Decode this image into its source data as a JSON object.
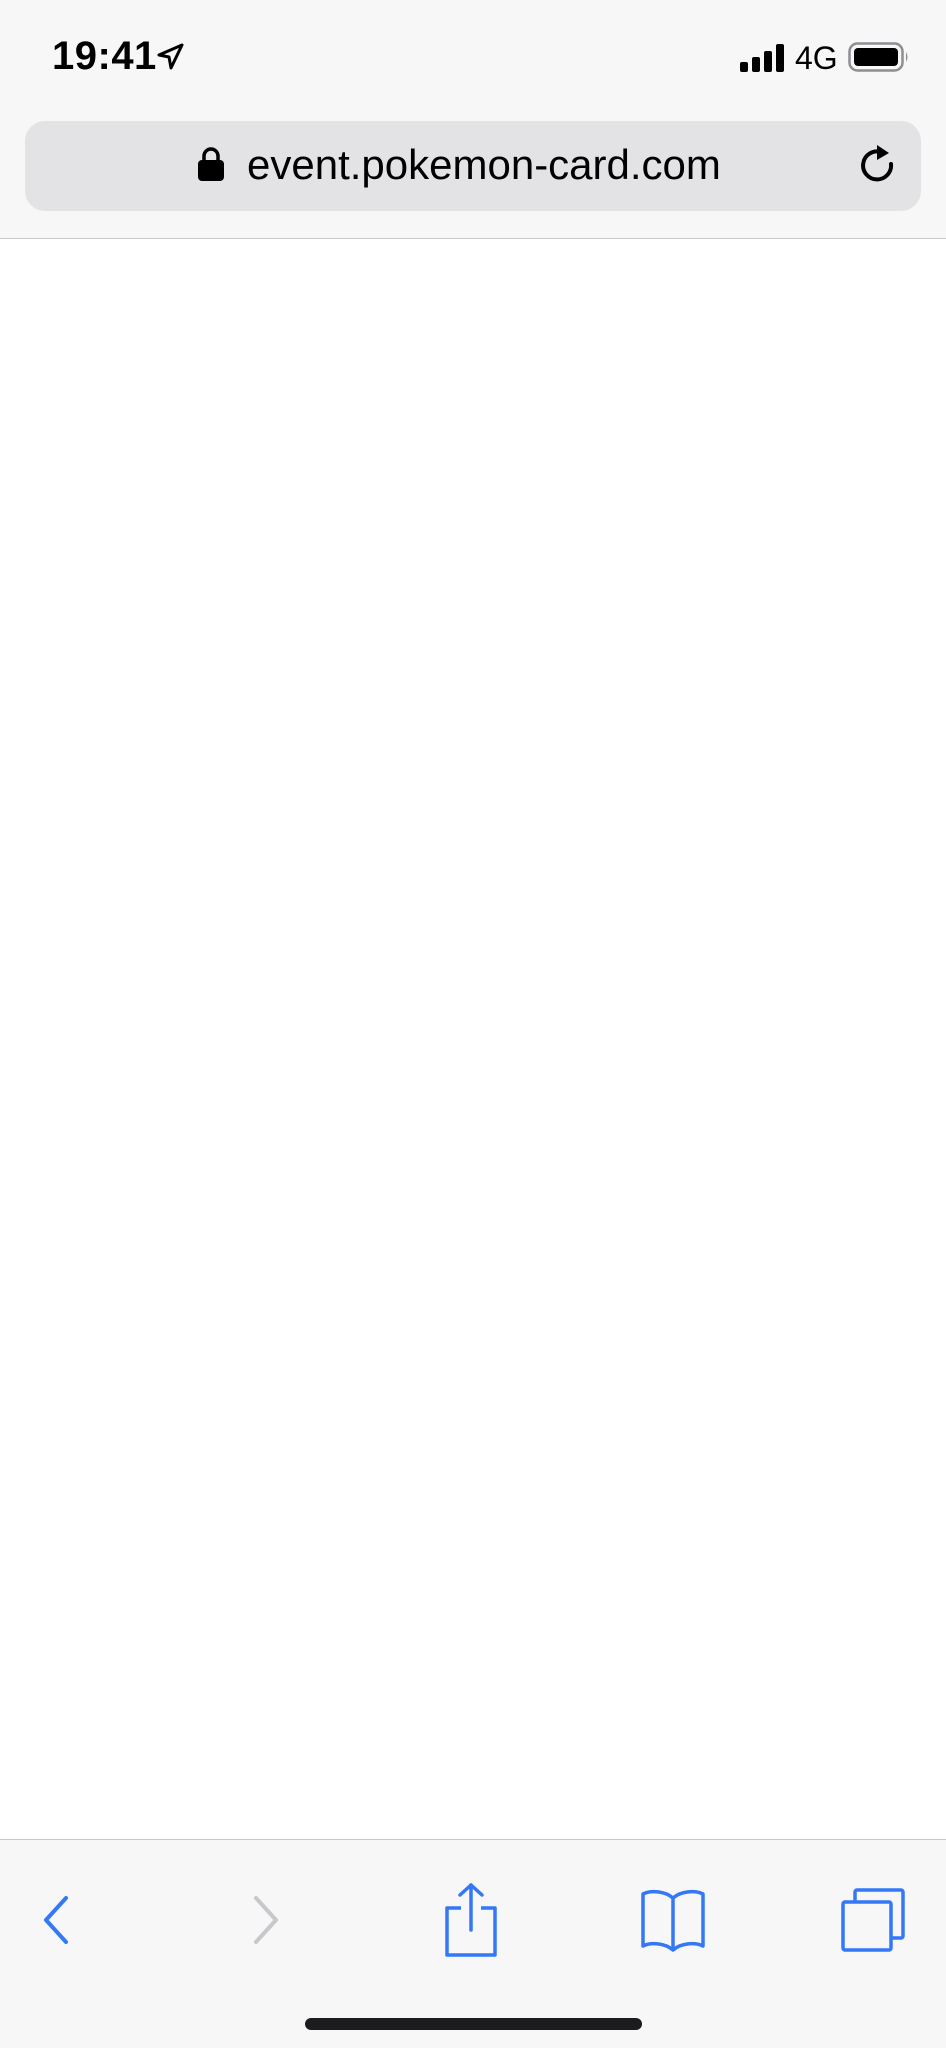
{
  "status_bar": {
    "time": "19:41",
    "network": "4G",
    "icons": {
      "location": "location-arrow-icon",
      "signal": "cellular-signal-icon",
      "battery": "battery-icon"
    }
  },
  "address_bar": {
    "url": "event.pokemon-card.com",
    "secure": true,
    "icons": {
      "lock": "lock-icon",
      "reload": "reload-icon"
    }
  },
  "toolbar": {
    "buttons": [
      {
        "name": "back",
        "icon": "chevron-left-icon",
        "enabled": true
      },
      {
        "name": "forward",
        "icon": "chevron-right-icon",
        "enabled": false
      },
      {
        "name": "share",
        "icon": "share-icon",
        "enabled": true
      },
      {
        "name": "bookmarks",
        "icon": "book-icon",
        "enabled": true
      },
      {
        "name": "tabs",
        "icon": "tabs-icon",
        "enabled": true
      }
    ]
  },
  "colors": {
    "accent": "#3478f6",
    "disabled": "#c7c7cc",
    "chrome_bg": "#f7f7f7",
    "url_bar_bg": "#e3e3e5"
  }
}
